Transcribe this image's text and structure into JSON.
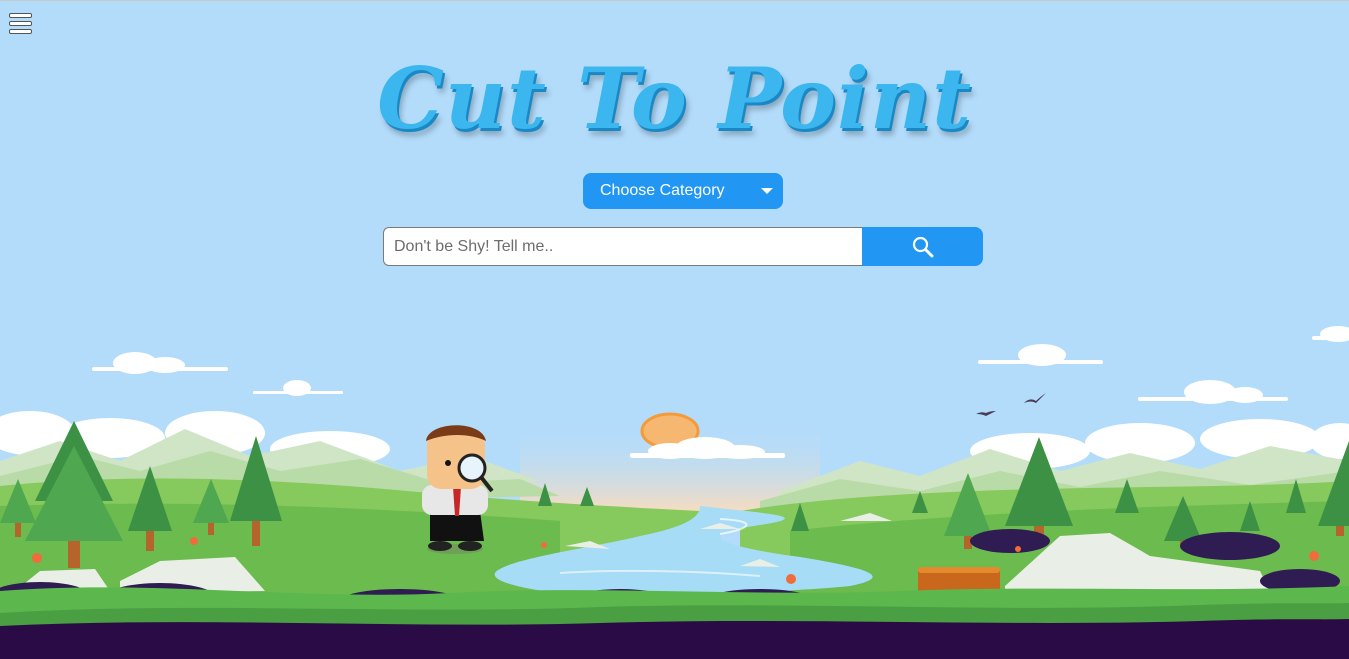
{
  "header": {
    "menu_icon": "hamburger-menu-icon",
    "logo_text": "Cut To Point"
  },
  "category": {
    "label": "Choose Category",
    "caret_icon": "caret-down-icon"
  },
  "search": {
    "placeholder": "Don't be Shy! Tell me..",
    "value": "",
    "button_icon": "search-icon"
  },
  "colors": {
    "sky": "#b3dcfb",
    "accent": "#2196f3",
    "logo": "#3cb6ee",
    "grass": "#5cb84d",
    "ground": "#2a0b45",
    "river": "#a6dcf5"
  }
}
